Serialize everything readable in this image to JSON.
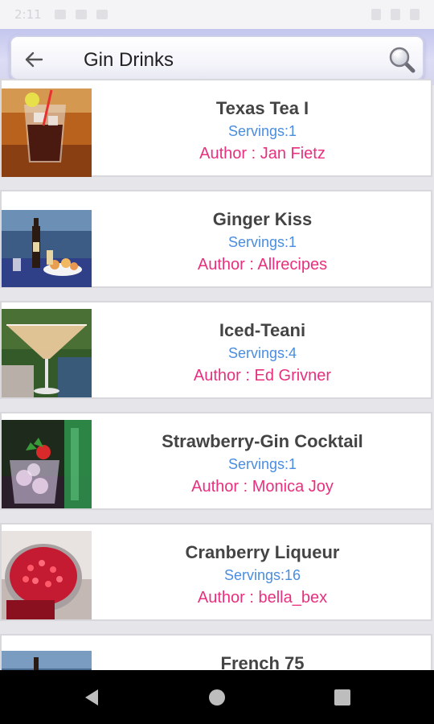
{
  "status_bar": {
    "time": "2:11"
  },
  "search": {
    "query": "Gin Drinks"
  },
  "recipes": [
    {
      "title": "Texas Tea I",
      "servings": "Servings:1",
      "author": "Author : Jan Fietz"
    },
    {
      "title": "Ginger Kiss",
      "servings": "Servings:1",
      "author": "Author : Allrecipes"
    },
    {
      "title": "Iced-Teani",
      "servings": "Servings:4",
      "author": "Author : Ed Grivner"
    },
    {
      "title": "Strawberry-Gin Cocktail",
      "servings": "Servings:1",
      "author": "Author : Monica Joy"
    },
    {
      "title": "Cranberry Liqueur",
      "servings": "Servings:16",
      "author": "Author : bella_bex"
    },
    {
      "title": "French 75",
      "servings": "",
      "author": ""
    }
  ],
  "colors": {
    "servings": "#4a8de0",
    "author": "#e8307e",
    "title": "#444444"
  }
}
